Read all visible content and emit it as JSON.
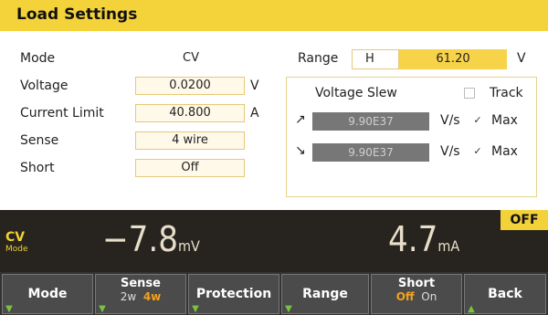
{
  "title": "Load Settings",
  "settings": {
    "mode": {
      "label": "Mode",
      "value": "CV"
    },
    "voltage": {
      "label": "Voltage",
      "value": "0.0200",
      "unit": "V"
    },
    "current_limit": {
      "label": "Current Limit",
      "value": "40.800",
      "unit": "A"
    },
    "sense": {
      "label": "Sense",
      "value": "4 wire"
    },
    "short": {
      "label": "Short",
      "value": "Off"
    }
  },
  "range": {
    "label": "Range",
    "selected": "H",
    "value": "61.20",
    "unit": "V"
  },
  "voltage_slew": {
    "label": "Voltage Slew",
    "track": {
      "label": "Track",
      "checked": false
    },
    "rise": {
      "value": "9.90E37",
      "unit": "V/s",
      "max_label": "Max",
      "max_checked": true
    },
    "fall": {
      "value": "9.90E37",
      "unit": "V/s",
      "max_label": "Max",
      "max_checked": true
    }
  },
  "measurement": {
    "voltage_value": "−7.8",
    "voltage_unit": "mV",
    "current_value": "4.7",
    "current_unit": "mA",
    "mode_badge": "CV",
    "mode_badge_sub": "Mode",
    "output_state": "OFF"
  },
  "softkeys": {
    "mode": "Mode",
    "sense": {
      "label": "Sense",
      "opt1": "2w",
      "opt2": "4w"
    },
    "protection": "Protection",
    "range": "Range",
    "short": {
      "label": "Short",
      "off": "Off",
      "on": "On"
    },
    "back": "Back"
  },
  "colors": {
    "accent": "#f4d23a",
    "measure_bg": "#27231f",
    "softkey_bg": "#4b4b4b",
    "highlight": "#f4a21c"
  }
}
